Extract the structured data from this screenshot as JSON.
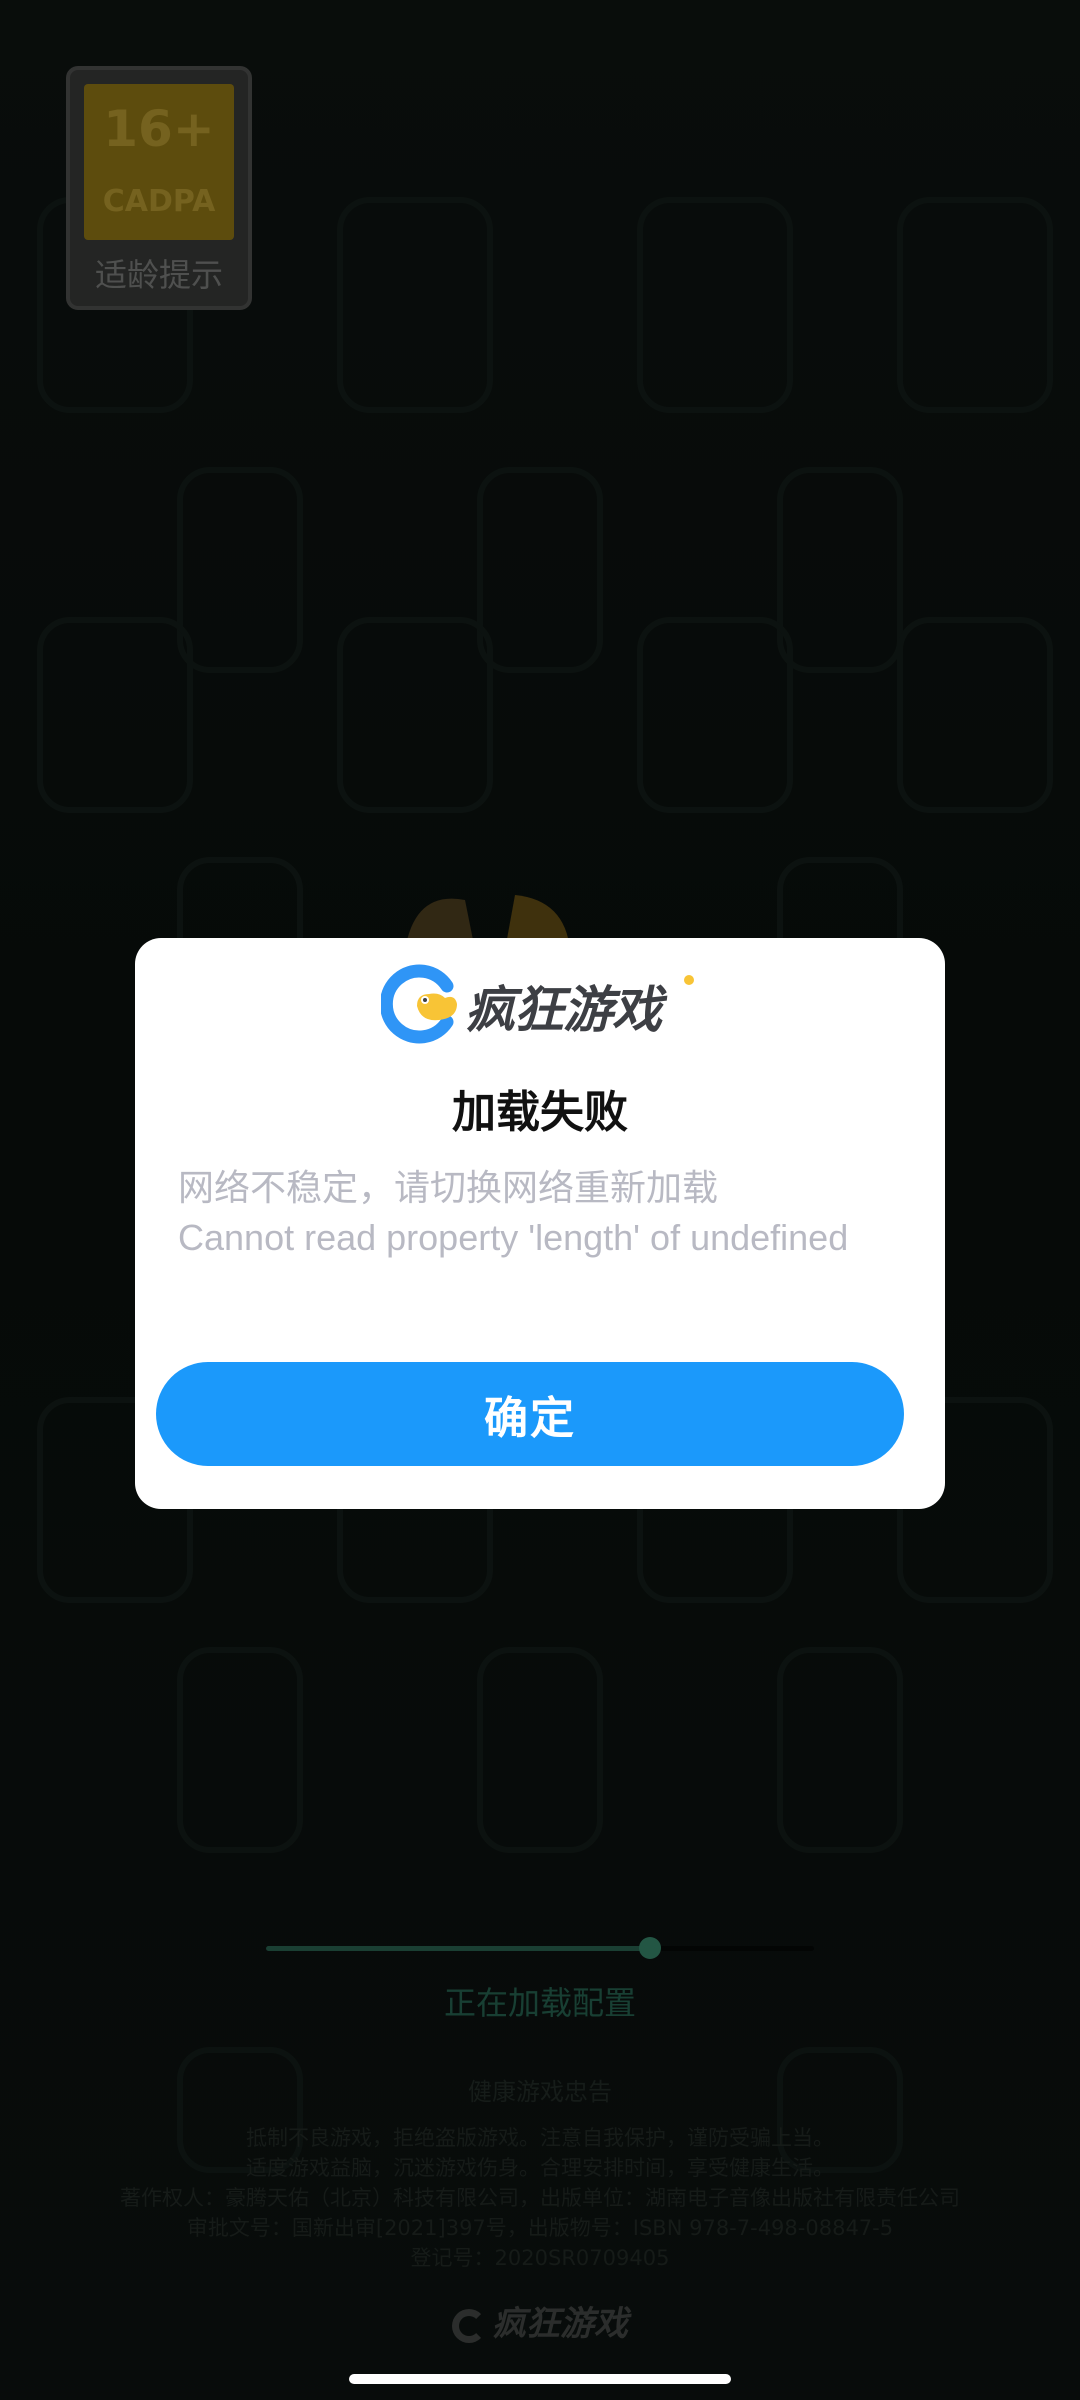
{
  "age_rating": {
    "number": "16+",
    "org": "CADPA",
    "label": "适龄提示"
  },
  "loading": {
    "progress": 0.7,
    "status_text": "正在加载配置"
  },
  "health_notice": {
    "title": "健康游戏忠告",
    "lines": [
      "抵制不良游戏，拒绝盗版游戏。注意自我保护，谨防受骗上当。",
      "适度游戏益脑，沉迷游戏伤身。合理安排时间，享受健康生活。",
      "著作权人：豪腾天佑（北京）科技有限公司，出版单位：湖南电子音像出版社有限责任公司",
      "审批文号：国新出审[2021]397号，出版物号：ISBN 978-7-498-08847-5",
      "登记号：2020SR0709405"
    ]
  },
  "brand": {
    "name": "疯狂游戏",
    "logo_icon": "crazy-games-c-logo",
    "accent_color": "#1b99fb",
    "logo_blue": "#2f95f6",
    "logo_yellow": "#f8c436"
  },
  "dialog": {
    "title": "加载失败",
    "message_lines": [
      "网络不稳定，请切换网络重新加载",
      "Cannot read property 'length' of undefined"
    ],
    "confirm_label": "确定"
  }
}
